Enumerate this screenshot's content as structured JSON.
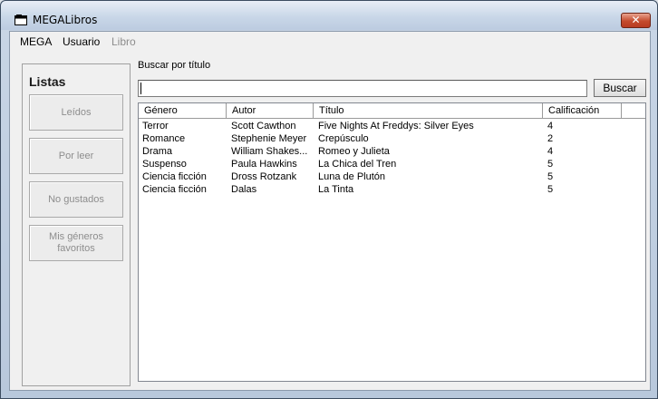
{
  "window": {
    "title": "MEGALibros",
    "close_glyph": "✕"
  },
  "menu": {
    "items": [
      "MEGA",
      "Usuario",
      "Libro"
    ]
  },
  "lists": {
    "title": "Listas",
    "buttons": [
      "Leídos",
      "Por leer",
      "No gustados",
      "Mis géneros favoritos"
    ]
  },
  "search": {
    "label": "Buscar por título",
    "value": "",
    "button": "Buscar"
  },
  "table": {
    "columns": [
      "Género",
      "Autor",
      "Título",
      "Calificación"
    ],
    "rows": [
      [
        "Terror",
        "Scott Cawthon",
        "Five Nights At Freddys: Silver Eyes",
        "4"
      ],
      [
        "Romance",
        "Stephenie Meyer",
        "Crepúsculo",
        "2"
      ],
      [
        "Drama",
        "William Shakes...",
        "Romeo y Julieta",
        "4"
      ],
      [
        "Suspenso",
        "Paula Hawkins",
        "La Chica del Tren",
        "5"
      ],
      [
        "Ciencia ficción",
        "Dross Rotzank",
        "Luna de Plutón",
        "5"
      ],
      [
        "Ciencia ficción",
        "Dalas",
        "La Tinta",
        "5"
      ]
    ]
  }
}
